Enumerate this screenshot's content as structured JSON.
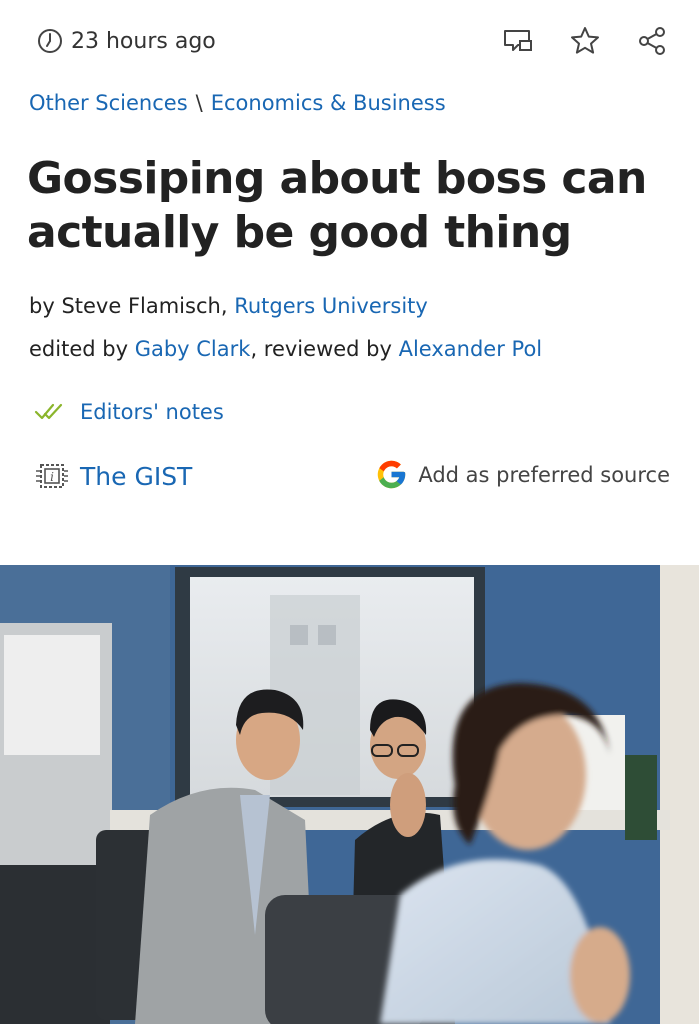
{
  "meta": {
    "time_ago": "23 hours ago",
    "icons": [
      "clock-icon",
      "comment-icon",
      "star-icon",
      "share-icon"
    ]
  },
  "breadcrumb": {
    "items": [
      "Other Sciences",
      "Economics & Business"
    ],
    "separator": "\\"
  },
  "article": {
    "title": "Gossiping about boss can actually be good thing",
    "byline": {
      "prefix": "by ",
      "author": "Steve Flamisch",
      "comma": ", ",
      "institution": "Rutgers University"
    },
    "edit_line": {
      "prefix": "edited by ",
      "editor": "Gaby Clark",
      "middle": ", reviewed by ",
      "reviewer": "Alexander Pol"
    },
    "editors_notes": "Editors' notes",
    "gist": "The GIST",
    "preferred_source": "Add as preferred source"
  },
  "colors": {
    "link": "#1967b3",
    "title": "#222222",
    "check_green": "#8bb52c",
    "wall_blue": "#3f6796"
  }
}
